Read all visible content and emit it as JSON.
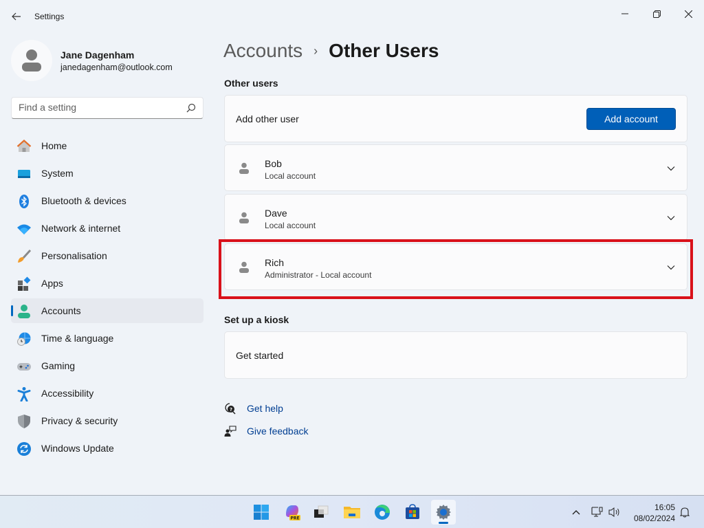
{
  "window": {
    "title": "Settings",
    "controls": [
      "minimize",
      "restore",
      "close"
    ]
  },
  "profile": {
    "name": "Jane Dagenham",
    "email": "janedagenham@outlook.com"
  },
  "search": {
    "placeholder": "Find a setting",
    "value": ""
  },
  "sidebar": {
    "items": [
      {
        "label": "Home",
        "icon": "home-icon"
      },
      {
        "label": "System",
        "icon": "system-icon"
      },
      {
        "label": "Bluetooth & devices",
        "icon": "bluetooth-icon"
      },
      {
        "label": "Network & internet",
        "icon": "wifi-icon"
      },
      {
        "label": "Personalisation",
        "icon": "brush-icon"
      },
      {
        "label": "Apps",
        "icon": "apps-icon"
      },
      {
        "label": "Accounts",
        "icon": "accounts-icon",
        "active": true
      },
      {
        "label": "Time & language",
        "icon": "globe-clock-icon"
      },
      {
        "label": "Gaming",
        "icon": "gamepad-icon"
      },
      {
        "label": "Accessibility",
        "icon": "accessibility-icon"
      },
      {
        "label": "Privacy & security",
        "icon": "shield-icon"
      },
      {
        "label": "Windows Update",
        "icon": "update-icon"
      }
    ]
  },
  "breadcrumb": {
    "parent": "Accounts",
    "separator": "›",
    "current": "Other Users"
  },
  "other_users": {
    "section_title": "Other users",
    "add_label": "Add other user",
    "add_button": "Add account",
    "users": [
      {
        "name": "Bob",
        "type": "Local account"
      },
      {
        "name": "Dave",
        "type": "Local account"
      },
      {
        "name": "Rich",
        "type": "Administrator - Local account",
        "highlighted": true
      }
    ]
  },
  "kiosk": {
    "section_title": "Set up a kiosk",
    "label": "Get started"
  },
  "links": {
    "help": "Get help",
    "feedback": "Give feedback"
  },
  "highlight_color": "#d9111a",
  "accent_color": "#005fb8",
  "taskbar": {
    "apps": [
      "start",
      "copilot-pre",
      "task-view",
      "file-explorer",
      "edge",
      "store",
      "settings"
    ],
    "active_app": "settings",
    "time": "16:05",
    "date": "08/02/2024"
  }
}
